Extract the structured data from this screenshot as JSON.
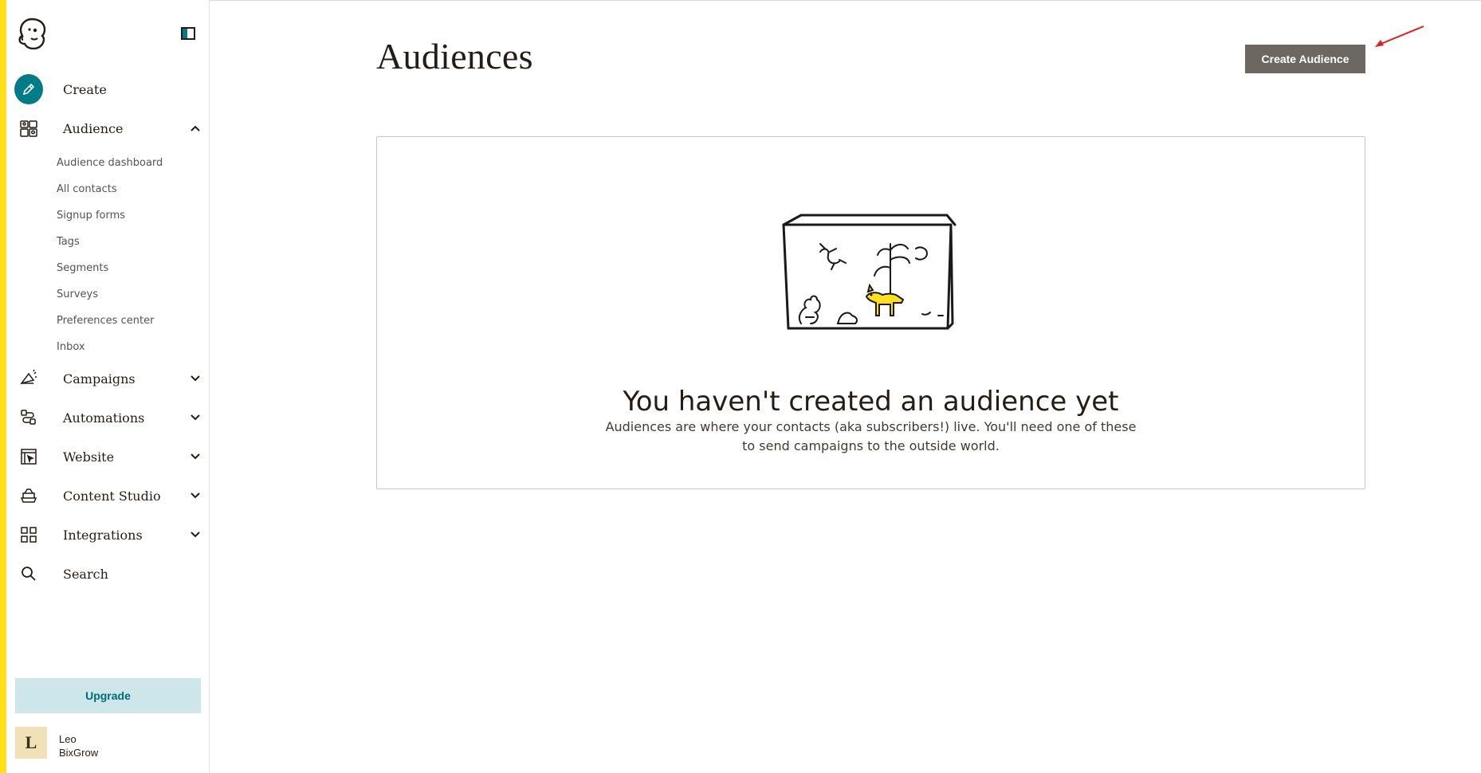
{
  "sidebar": {
    "logo_icon": "mailchimp-freddie-icon",
    "collapse_icon": "sidebar-toggle-icon",
    "nav": {
      "create": "Create",
      "audience": "Audience",
      "campaigns": "Campaigns",
      "automations": "Automations",
      "website": "Website",
      "content_studio": "Content Studio",
      "integrations": "Integrations",
      "search": "Search"
    },
    "audience_sub": {
      "dashboard": "Audience dashboard",
      "all_contacts": "All contacts",
      "signup_forms": "Signup forms",
      "tags": "Tags",
      "segments": "Segments",
      "surveys": "Surveys",
      "preferences_center": "Preferences center",
      "inbox": "Inbox"
    },
    "upgrade_label": "Upgrade",
    "user": {
      "initial": "L",
      "name": "Leo",
      "org": "BixGrow"
    }
  },
  "main": {
    "title": "Audiences",
    "create_button": "Create Audience",
    "empty_state": {
      "heading": "You haven't created an audience yet",
      "description_line1": "Audiences are where your contacts (aka subscribers!) live. You'll need one of these",
      "description_line2": "to send campaigns to the outside world."
    }
  },
  "colors": {
    "accent_teal": "#007c89",
    "brand_yellow": "#ffe01b",
    "button_gray": "#6d6762",
    "upgrade_bg": "#cde6ea",
    "annotation_red": "#e02020"
  }
}
